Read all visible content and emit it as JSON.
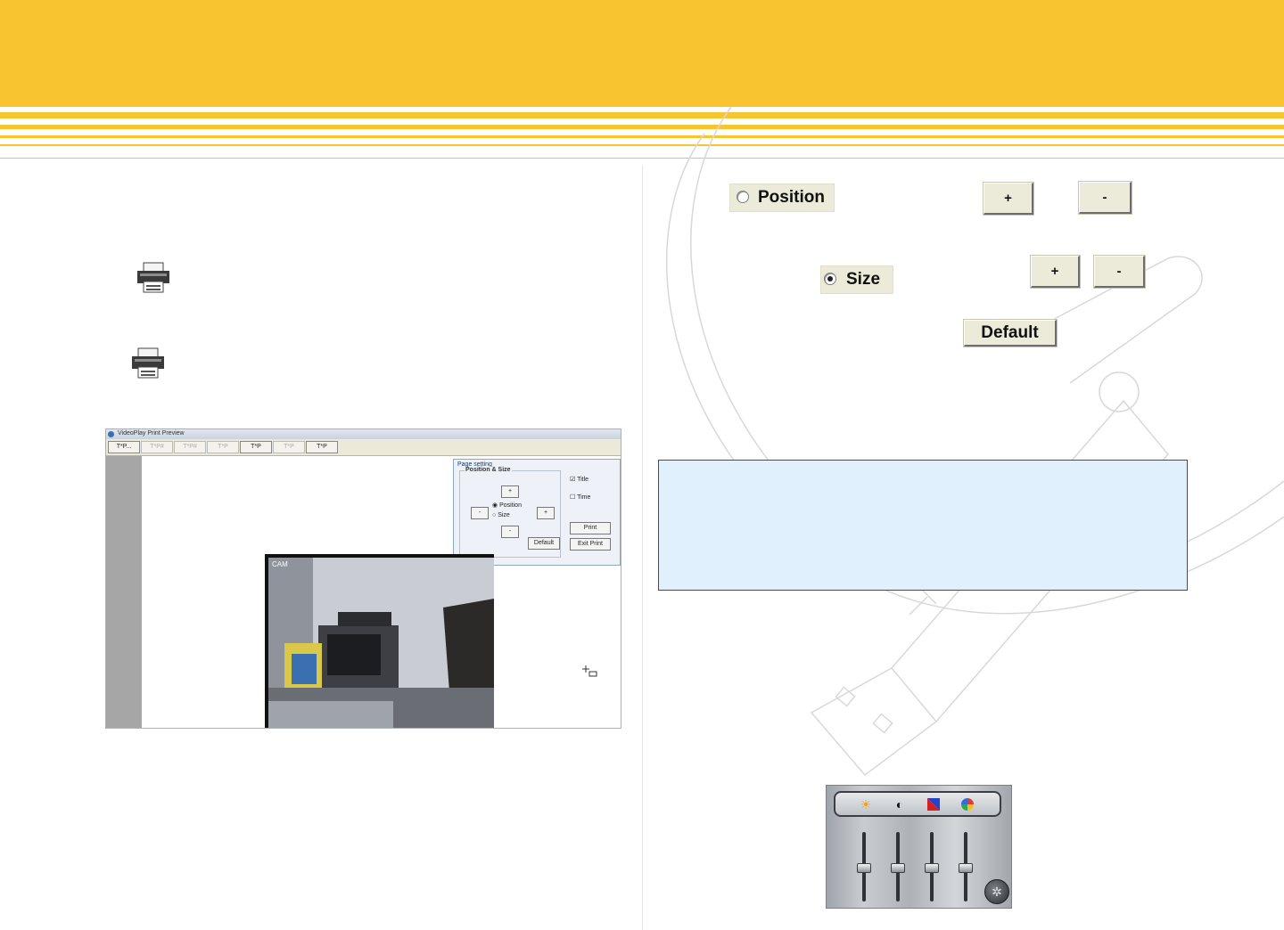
{
  "preview": {
    "window_title": "VideoPlay Print Preview",
    "toolbar": [
      "T*P...",
      "T*P#",
      "T*P#",
      "T*P",
      "T*P",
      "T*P",
      "T*P"
    ],
    "panel": {
      "title": "Page setting",
      "group_title": "Position & Size",
      "up": "+",
      "left": "-",
      "right": "+",
      "down": "-",
      "position_label": "Position",
      "size_label": "Size",
      "default_label": "Default",
      "title_check_label": "Title",
      "time_check_label": "Time",
      "print_label": "Print",
      "exit_label": "Exit Print",
      "title_checked": true,
      "time_checked": false
    }
  },
  "controls": {
    "position_label": "Position",
    "size_label": "Size",
    "position_selected": false,
    "size_selected": true,
    "plus": "+",
    "minus": "-",
    "default_label": "Default"
  },
  "equalizer": {
    "icons": [
      "sun-icon",
      "contrast-icon",
      "color-icon",
      "saturation-icon"
    ],
    "levels": [
      0.5,
      0.5,
      0.5,
      0.5
    ]
  },
  "colors": {
    "header": "#f8c430",
    "note_box": "#e0f0fc"
  }
}
